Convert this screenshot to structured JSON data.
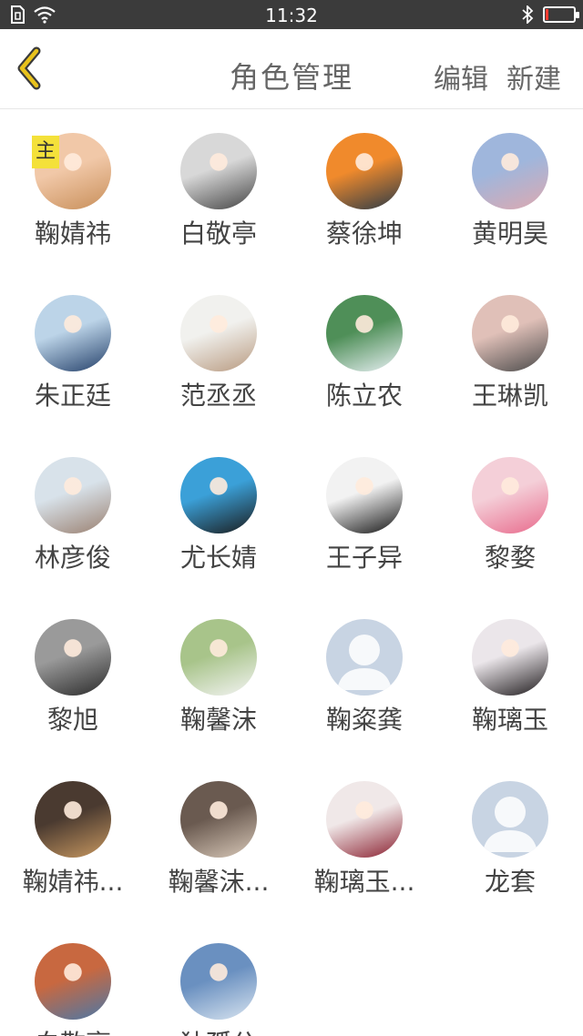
{
  "status_bar": {
    "time": "11:32"
  },
  "header": {
    "title": "角色管理",
    "edit_label": "编辑",
    "new_label": "新建",
    "accent_color": "#d8b41a"
  },
  "roles": [
    {
      "name": "鞠婧祎",
      "badge": "主",
      "avatar": "photo",
      "colors": [
        "#f1c8a8",
        "#c88f5a"
      ]
    },
    {
      "name": "白敬亭",
      "avatar": "photo",
      "colors": [
        "#d8d8d8",
        "#444444"
      ]
    },
    {
      "name": "蔡徐坤",
      "avatar": "photo",
      "colors": [
        "#f08a2c",
        "#2a3a48"
      ]
    },
    {
      "name": "黄明昊",
      "avatar": "photo",
      "colors": [
        "#9fb6dc",
        "#dda9b0"
      ]
    },
    {
      "name": "朱正廷",
      "avatar": "photo",
      "colors": [
        "#bcd4e8",
        "#24406a"
      ]
    },
    {
      "name": "范丞丞",
      "avatar": "photo",
      "colors": [
        "#f1f1ee",
        "#b89a80"
      ]
    },
    {
      "name": "陈立农",
      "avatar": "photo",
      "colors": [
        "#4f8f58",
        "#e8f0f4"
      ]
    },
    {
      "name": "王琳凯",
      "avatar": "photo",
      "colors": [
        "#e0c0b8",
        "#4a4a4a"
      ]
    },
    {
      "name": "林彦俊",
      "avatar": "photo",
      "colors": [
        "#d8e2ea",
        "#9a8070"
      ]
    },
    {
      "name": "尤长婧",
      "avatar": "photo",
      "colors": [
        "#3ba0d8",
        "#1a1a1a"
      ]
    },
    {
      "name": "王子异",
      "avatar": "photo",
      "colors": [
        "#f2f2f2",
        "#141414"
      ]
    },
    {
      "name": "黎婺",
      "avatar": "photo",
      "colors": [
        "#f4cfd8",
        "#e86a8c"
      ]
    },
    {
      "name": "黎旭",
      "avatar": "photo",
      "colors": [
        "#9a9a9a",
        "#2a2a2a"
      ]
    },
    {
      "name": "鞠馨沫",
      "avatar": "photo",
      "colors": [
        "#a8c48a",
        "#f4f4f4"
      ]
    },
    {
      "name": "鞠粢龚",
      "avatar": "placeholder"
    },
    {
      "name": "鞠璃玉",
      "avatar": "photo",
      "colors": [
        "#ebe6ea",
        "#1e1a1c"
      ]
    },
    {
      "name": "鞠婧祎...",
      "avatar": "photo",
      "colors": [
        "#4a3a30",
        "#c89860"
      ]
    },
    {
      "name": "鞠馨沫...",
      "avatar": "photo",
      "colors": [
        "#6a5a50",
        "#d8c8b8"
      ]
    },
    {
      "name": "鞠璃玉...",
      "avatar": "photo",
      "colors": [
        "#f0e8e8",
        "#8a2030"
      ]
    },
    {
      "name": "龙套",
      "avatar": "placeholder"
    },
    {
      "name": "白敬亭",
      "avatar": "photo",
      "colors": [
        "#c86840",
        "#4a78a8"
      ]
    },
    {
      "name": "独孤公",
      "avatar": "photo",
      "colors": [
        "#6a90c0",
        "#d8e4f0"
      ]
    }
  ]
}
